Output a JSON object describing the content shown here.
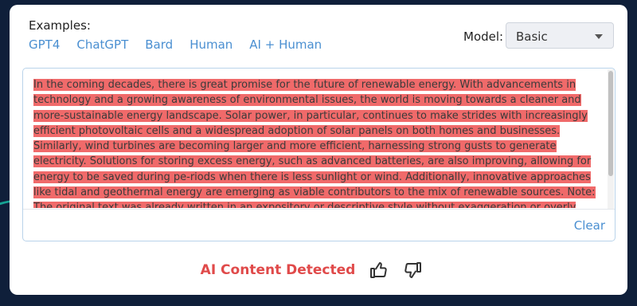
{
  "examples": {
    "label": "Examples:",
    "links": [
      "GPT4",
      "ChatGPT",
      "Bard",
      "Human",
      "AI + Human"
    ]
  },
  "model": {
    "label": "Model:",
    "selected": "Basic"
  },
  "input": {
    "text": "In the coming decades, there is great promise for the future of renewable energy. With advancements in technology and a growing awareness of environmental issues, the world is moving towards a cleaner and more-sustainable energy landscape. Solar power, in particular, continues to make strides with increasingly efficient photovoltaic cells and a widespread adoption of solar panels on both homes and businesses. Similarly, wind turbines are becoming larger and more efficient, harnessing strong gusts to generate electricity. Solutions for storing excess energy, such as advanced batteries, are also improving, allowing for energy to be saved during pe-riods when there is less sunlight or wind. Additionally, innovative approaches like tidal and geothermal energy are emerging as viable contributors to the mix of renewable sources. Note: The original text was already written in an expository or descriptive style without exaggeration or overly complicated language. Therefore, my",
    "clear_label": "Clear"
  },
  "result": {
    "label": "AI Content Detected",
    "color": "#e04a4a"
  },
  "icons": {
    "thumbs_up": "thumbs-up-icon",
    "thumbs_down": "thumbs-down-icon",
    "dropdown": "chevron-down-icon"
  },
  "colors": {
    "highlight": "#f06a6a",
    "link": "#4a8fd1",
    "background": "#0f1f3a"
  }
}
